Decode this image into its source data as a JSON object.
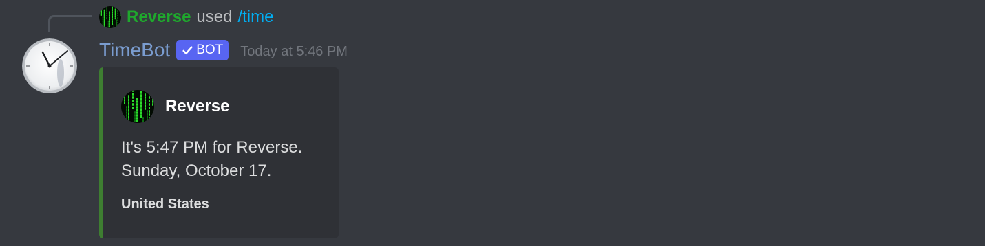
{
  "interaction": {
    "user_name": "Reverse",
    "used_text": "used",
    "command": "/time",
    "user_avatar_icon": "matrix-code-avatar"
  },
  "message": {
    "author_name": "TimeBot",
    "author_avatar_icon": "clock-avatar",
    "bot_tag": "BOT",
    "bot_tag_icon": "verified-check-icon",
    "timestamp": "Today at 5:46 PM"
  },
  "embed": {
    "color": "#3e7e31",
    "author": {
      "name": "Reverse",
      "avatar_icon": "matrix-code-avatar"
    },
    "description_lines": [
      "It's 5:47 PM for Reverse.",
      "Sunday, October 17."
    ],
    "field_name": "United States"
  },
  "colors": {
    "background": "#36393f",
    "embed_background": "#2f3136",
    "reply_user": "#1fa82d",
    "command_link": "#00aff4",
    "bot_name": "#7a9ccf",
    "bot_tag": "#5865f2"
  }
}
